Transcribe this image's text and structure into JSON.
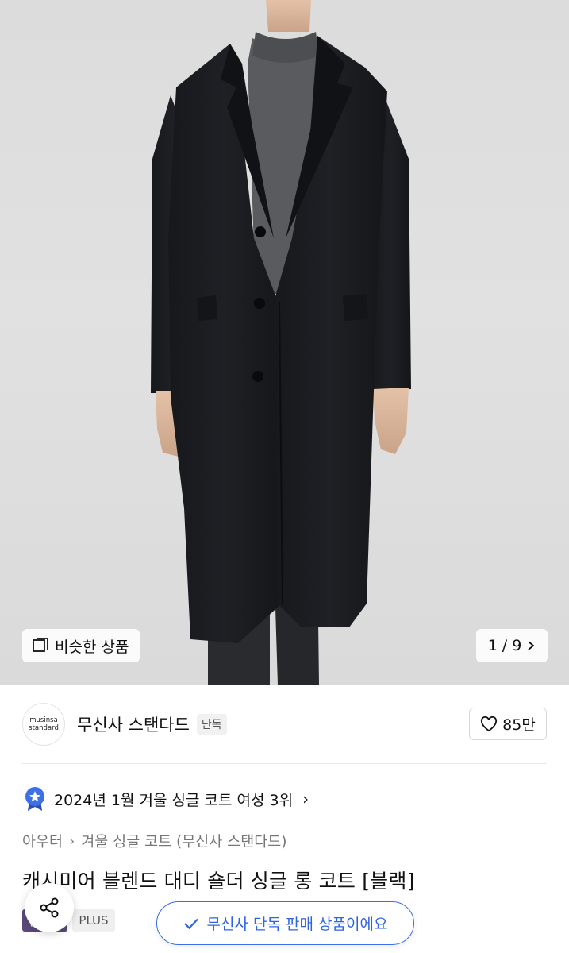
{
  "gallery": {
    "similar_label": "비슷한 상품",
    "similar_icon": "similar-items-icon",
    "pager_current": "1",
    "pager_sep": "/",
    "pager_total": "9",
    "pager_icon": "chevron-right-icon"
  },
  "brand": {
    "logo_line1": "musinsa",
    "logo_line2": "standard",
    "name": "무신사 스탠다드",
    "badge": "단독",
    "likes": "85만",
    "like_icon": "heart-icon"
  },
  "ranking": {
    "icon": "ranking-badge-icon",
    "text": "2024년 1월 겨울 싱글 코트 여성 3위",
    "chevron": "›"
  },
  "breadcrumb": {
    "items": [
      "아우터",
      "겨울 싱글 코트 (무신사 스탠다드)"
    ],
    "separator": "›"
  },
  "product": {
    "title": "캐시미어 블렌드 대디 숄더 싱글 롱 코트 [블랙]"
  },
  "tags": {
    "sale": "한세일",
    "plus": "PLUS"
  },
  "overlay": {
    "share_icon": "share-icon",
    "exclusive_text": "무신사 단독 판매 상품이에요",
    "exclusive_icon": "check-icon"
  },
  "colors": {
    "accent_blue": "#2f63e0",
    "sale_tag": "#5a4a7a",
    "ranking_badge": "#3d6fe6"
  }
}
